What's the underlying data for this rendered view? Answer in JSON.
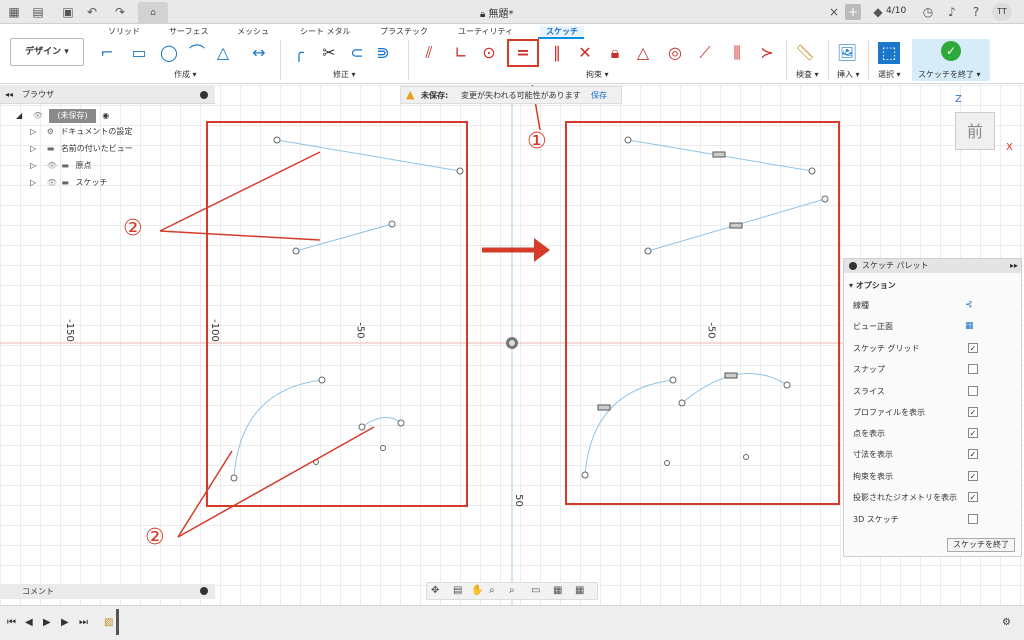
{
  "titlebar": {
    "doc_title": "無題*",
    "version": "4/10",
    "user_initials": "TT"
  },
  "ribbon": {
    "design_label": "デザイン ▾",
    "tabs": [
      "ソリッド",
      "サーフェス",
      "メッシュ",
      "シート メタル",
      "プラスチック",
      "ユーティリティ",
      "スケッチ"
    ],
    "groups": {
      "create": "作成 ▾",
      "modify": "修正 ▾",
      "constraints": "拘束 ▾",
      "inspect": "検査 ▾",
      "insert": "挿入 ▾",
      "select": "選択 ▾",
      "finish": "スケッチを終了 ▾"
    }
  },
  "warning": {
    "label": "未保存:",
    "message": "変更が失われる可能性があります",
    "save": "保存"
  },
  "browser": {
    "title": "ブラウザ",
    "items": [
      "(未保存)",
      "ドキュメントの設定",
      "名前の付いたビュー",
      "原点",
      "スケッチ"
    ]
  },
  "comments": {
    "label": "コメント"
  },
  "canvas": {
    "axis_labels": [
      "-150",
      "-100",
      "-50",
      "-50",
      "50"
    ],
    "annotations": {
      "one": "①",
      "two_a": "②",
      "two_b": "②"
    }
  },
  "viewcube": {
    "face": "前",
    "z": "Z",
    "x": "X"
  },
  "palette": {
    "title": "スケッチ パレット",
    "section": "オプション",
    "rows": [
      {
        "label": "線種",
        "type": "icon"
      },
      {
        "label": "ビュー正面",
        "type": "icon"
      },
      {
        "label": "スケッチ グリッド",
        "checked": true
      },
      {
        "label": "スナップ",
        "checked": false
      },
      {
        "label": "スライス",
        "checked": false
      },
      {
        "label": "プロファイルを表示",
        "checked": true
      },
      {
        "label": "点を表示",
        "checked": true
      },
      {
        "label": "寸法を表示",
        "checked": true
      },
      {
        "label": "拘束を表示",
        "checked": true
      },
      {
        "label": "投影されたジオメトリを表示",
        "checked": true
      },
      {
        "label": "3D スケッチ",
        "checked": false
      }
    ],
    "finish_button": "スケッチを終了"
  },
  "colors": {
    "accent": "#0a8ee6",
    "annotation_red": "#d63b2a",
    "sketch_line": "#8ec3e6"
  }
}
